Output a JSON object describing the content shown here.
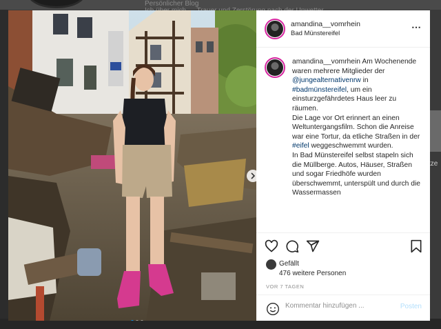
{
  "background": {
    "profile_subtitle": "Persönlicher Blog",
    "bio_fragment": "Ich über mich — Trauer und Zerstörung nach der Unwetter",
    "right_fragment": "tze"
  },
  "post": {
    "username": "amandina__vomrhein",
    "location": "Bad Münstereifel",
    "more_icon": "⋯",
    "caption": {
      "author": "amandina__vomrhein",
      "part1": " Am Wochenende waren mehrere Mitglieder der ",
      "mention": "@jungealternativenrw",
      "part2": " in ",
      "hashtag1": "#badmünstereifel",
      "part3": ", um ein einsturzgefährdetes Haus leer zu räumen.",
      "para2": "Die Lage vor Ort erinnert an einen Weltuntergangsfilm. Schon die Anreise war eine Tortur, da etliche Straßen in der ",
      "hashtag2": "#eifel",
      "part4": " weggeschwemmt wurden.",
      "para3": "In Bad Münstereifel selbst stapeln sich die Müllberge. Autos, Häuser, Straßen und sogar Friedhöfe wurden überschwemmt, unterspült und durch die Wassermassen"
    },
    "likes": {
      "line1": "Gefällt",
      "line2": "476 weitere Personen"
    },
    "time_ago": "VOR 7 TAGEN",
    "comment_placeholder": "Kommentar hinzufügen ...",
    "post_button": "Posten",
    "carousel": {
      "slides": 3,
      "active_index": 0
    }
  },
  "colors": {
    "link": "#00376b",
    "post_button": "#b2dffc",
    "story_ring": "#d6249f",
    "carousel_active": "#0095f6"
  }
}
